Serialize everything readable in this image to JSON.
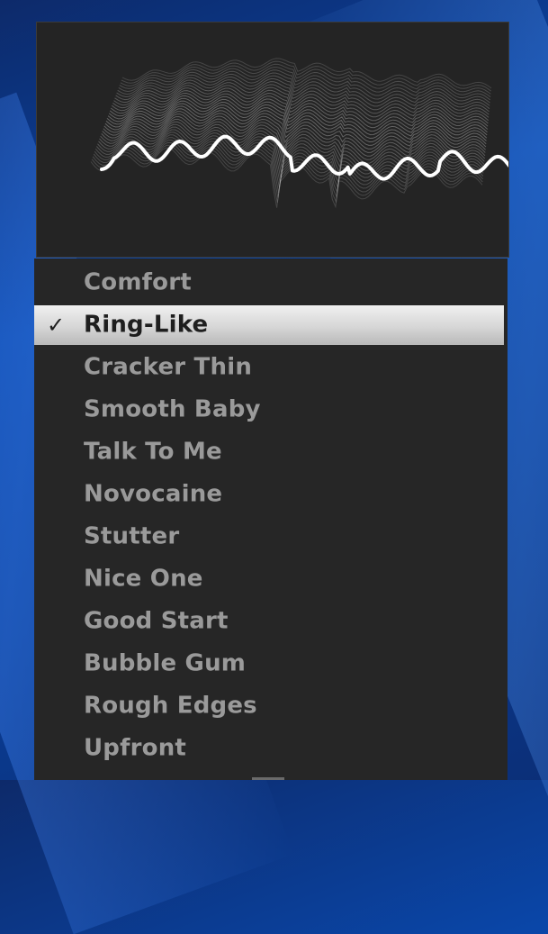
{
  "menu": {
    "selected_index": 1,
    "check_glyph": "✓",
    "items": [
      {
        "label": "Comfort"
      },
      {
        "label": "Ring-Like"
      },
      {
        "label": "Cracker Thin"
      },
      {
        "label": "Smooth Baby"
      },
      {
        "label": "Talk To Me"
      },
      {
        "label": "Novocaine"
      },
      {
        "label": "Stutter"
      },
      {
        "label": "Nice One"
      },
      {
        "label": "Good Start"
      },
      {
        "label": "Bubble Gum"
      },
      {
        "label": "Rough Edges"
      },
      {
        "label": "Upfront"
      }
    ]
  },
  "colors": {
    "menu_background": "#262626",
    "selected_highlight": "#d6d6d6",
    "item_text": "#9a9a9a",
    "selected_text": "#1e1e1e",
    "waveform_highlight": "#ffffff"
  }
}
